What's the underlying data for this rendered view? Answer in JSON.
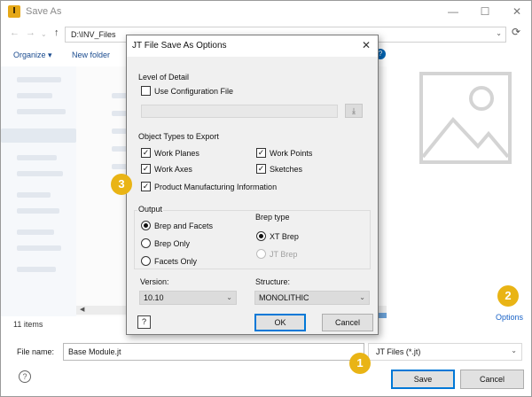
{
  "window": {
    "title": "Save As",
    "app_icon_letter": "I",
    "accent": "#0078d7",
    "callout_color": "#e9b415"
  },
  "address": {
    "path": "D:\\INV_Files"
  },
  "toolbar": {
    "organize": "Organize ▾",
    "new_folder": "New folder"
  },
  "status": {
    "items_count": "11 items"
  },
  "preview": {
    "options_link": "Options"
  },
  "filename": {
    "label": "File name:",
    "value": "Base Module.jt"
  },
  "filetype": {
    "value": "JT Files (*.jt)"
  },
  "buttons": {
    "save": "Save",
    "cancel": "Cancel"
  },
  "callouts": [
    "1",
    "2",
    "3"
  ],
  "dialog": {
    "title": "JT File Save As Options",
    "level_of_detail": {
      "label": "Level of Detail",
      "use_config_file": "Use Configuration File",
      "use_config_checked": false
    },
    "object_types": {
      "label": "Object Types to Export",
      "items": [
        {
          "label": "Work Planes",
          "checked": true
        },
        {
          "label": "Work Points",
          "checked": true
        },
        {
          "label": "Work Axes",
          "checked": true
        },
        {
          "label": "Sketches",
          "checked": true
        },
        {
          "label": "Product Manufacturing Information",
          "checked": true
        }
      ]
    },
    "output": {
      "label": "Output",
      "options": [
        {
          "label": "Brep and Facets",
          "selected": true
        },
        {
          "label": "Brep Only",
          "selected": false
        },
        {
          "label": "Facets Only",
          "selected": false
        }
      ]
    },
    "brep_type": {
      "label": "Brep type",
      "options": [
        {
          "label": "XT Brep",
          "selected": true,
          "enabled": true
        },
        {
          "label": "JT Brep",
          "selected": false,
          "enabled": false
        }
      ]
    },
    "version": {
      "label": "Version:",
      "value": "10.10"
    },
    "structure": {
      "label": "Structure:",
      "value": "MONOLITHIC"
    },
    "help_icon": "?",
    "ok": "OK",
    "cancel": "Cancel"
  }
}
